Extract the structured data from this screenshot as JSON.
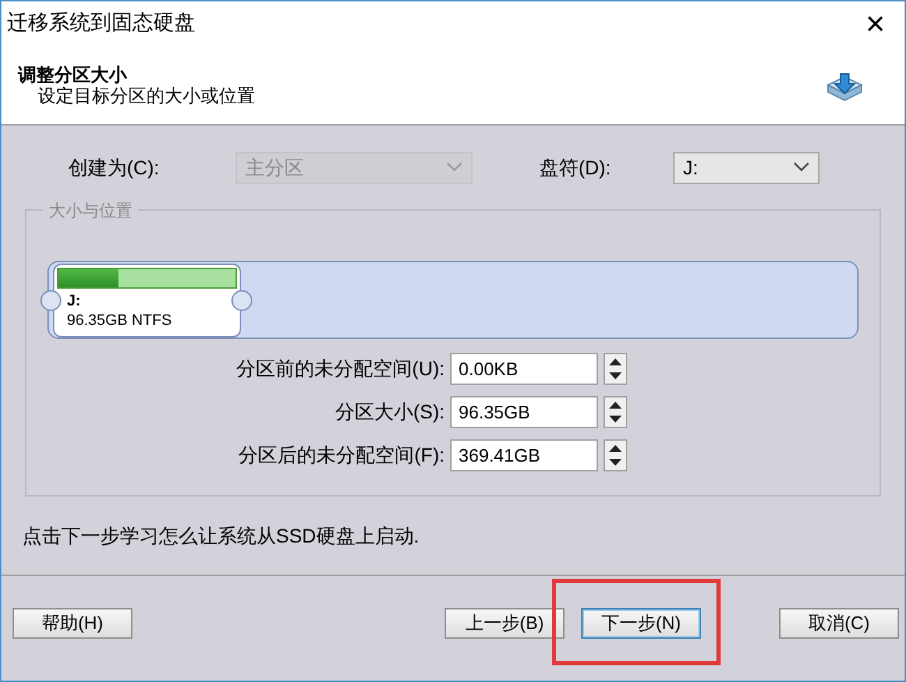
{
  "window": {
    "title": "迁移系统到固态硬盘",
    "close": "×"
  },
  "header": {
    "title": "调整分区大小",
    "subtitle": "设定目标分区的大小或位置"
  },
  "create_as": {
    "label": "创建为(C):",
    "value": "主分区",
    "disabled": true
  },
  "drive_letter": {
    "label": "盘符(D):",
    "value": "J:",
    "disabled": false
  },
  "group": {
    "title": "大小与位置"
  },
  "partition": {
    "letter": "J:",
    "info": "96.35GB NTFS",
    "level": 0.34
  },
  "fields": [
    {
      "label": "分区前的未分配空间(U):",
      "value": "0.00KB"
    },
    {
      "label": "分区大小(S):",
      "value": "96.35GB"
    },
    {
      "label": "分区后的未分配空间(F):",
      "value": "369.41GB"
    }
  ],
  "hint": "点击下一步学习怎么让系统从SSD硬盘上启动.",
  "buttons": [
    {
      "label": "帮助(H)",
      "kind": "left",
      "focused": false
    },
    {
      "label": "上一步(B)",
      "kind": "right",
      "focused": false
    },
    {
      "label": "下一步(N)",
      "kind": "right",
      "focused": true
    },
    {
      "label": "取消(C)",
      "kind": "right",
      "focused": false
    }
  ]
}
